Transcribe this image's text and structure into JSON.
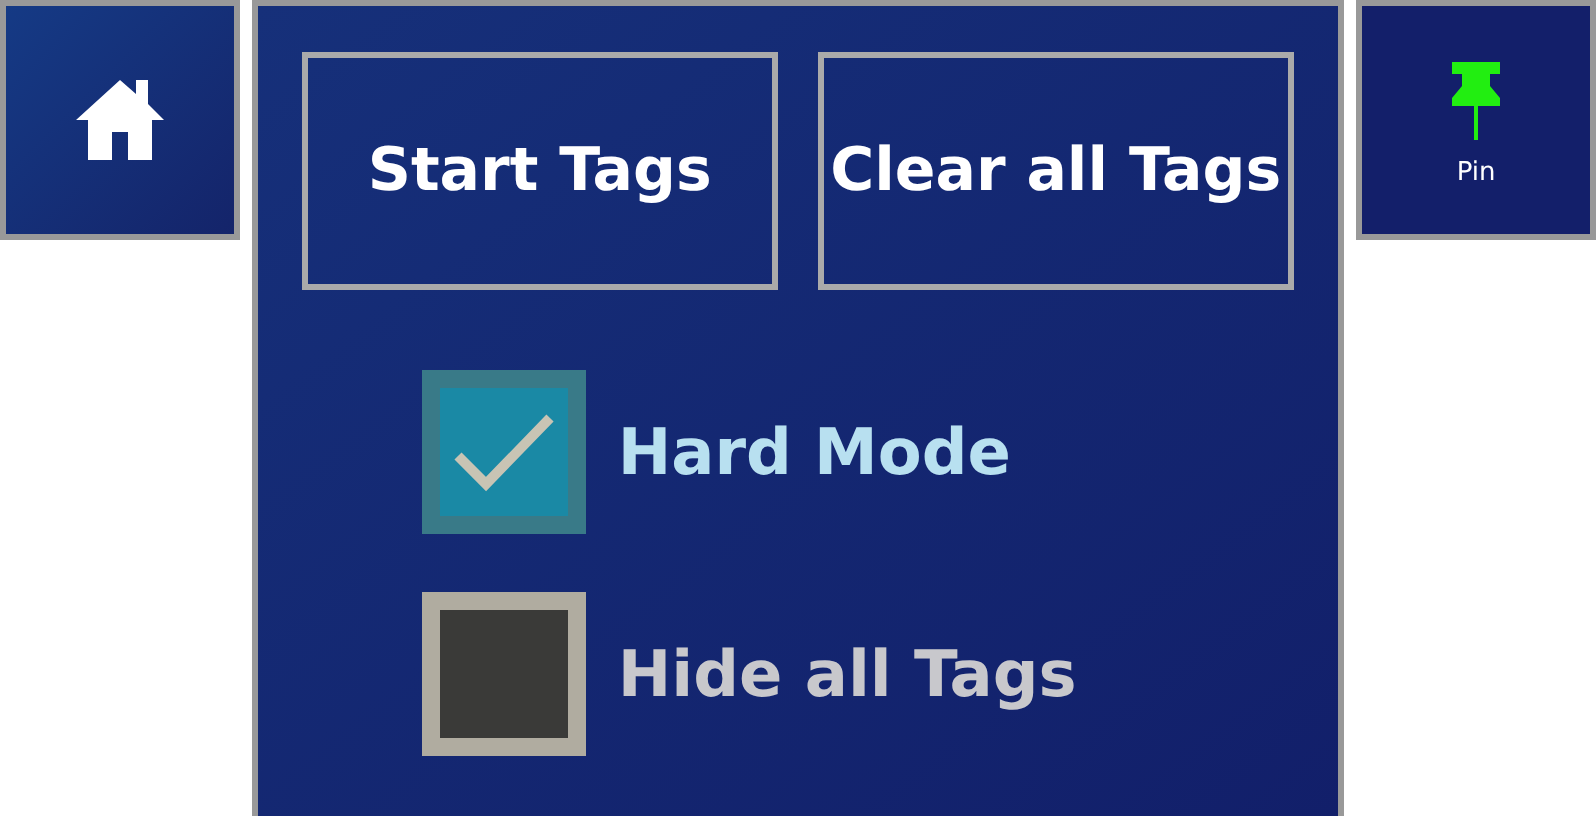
{
  "buttons": [
    {
      "label": "Start Tags"
    },
    {
      "label": "Clear all Tags"
    }
  ],
  "options": [
    {
      "label": "Hard Mode",
      "checked": true
    },
    {
      "label": "Hide all Tags",
      "checked": false
    }
  ],
  "pin_button": {
    "label": "Pin"
  }
}
